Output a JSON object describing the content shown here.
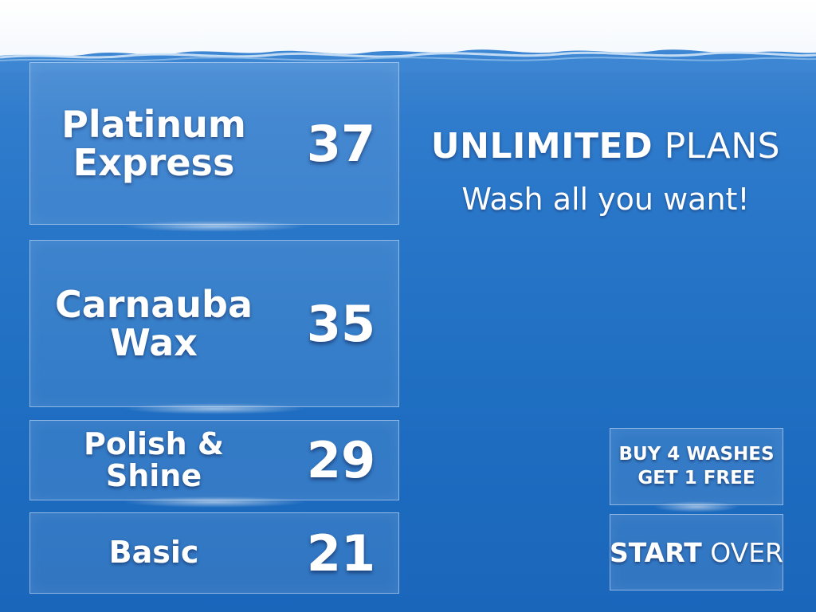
{
  "header": {
    "headline_bold": "UNLIMITED",
    "headline_light": "PLANS",
    "subline": "Wash all you want!"
  },
  "plans": [
    {
      "name_line1": "Platinum",
      "name_line2": "Express",
      "price": "37"
    },
    {
      "name_line1": "Carnauba",
      "name_line2": "Wax",
      "price": "35"
    },
    {
      "name_line1": "Polish &",
      "name_line2": "Shine",
      "price": "29"
    },
    {
      "name_line1": "Basic",
      "name_line2": "",
      "price": "21"
    }
  ],
  "buttons": {
    "promo_line1": "BUY 4 WASHES",
    "promo_line2": "GET 1 FREE",
    "start_bold": "START",
    "start_light": "OVER"
  },
  "colors": {
    "water_top": "#4a8ed6",
    "water_bottom": "#1a66bb",
    "text": "#ffffff"
  }
}
